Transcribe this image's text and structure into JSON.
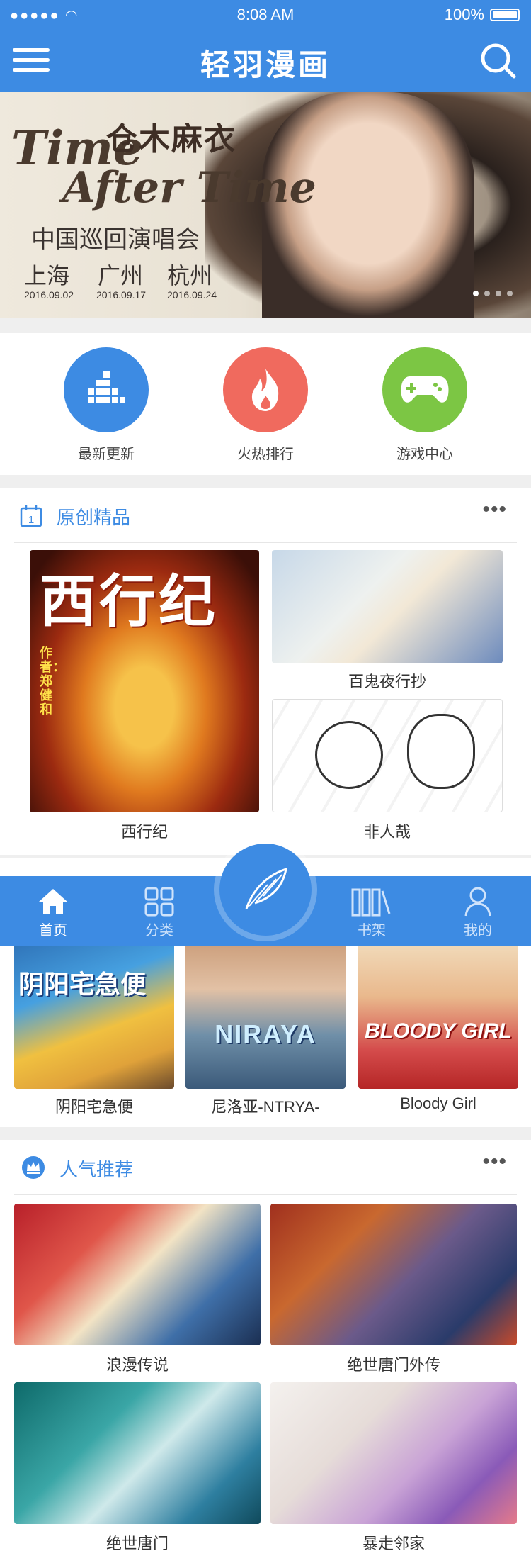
{
  "status": {
    "signal": "●●●●● ",
    "time": "8:08 AM",
    "battery": "100%"
  },
  "header": {
    "title": "轻羽漫画"
  },
  "banner": {
    "line1": "Time",
    "line2": "After Time",
    "artist": "仓木麻衣",
    "subtitle": "中国巡回演唱会",
    "cities": [
      {
        "city": "上海",
        "date": "2016.09.02"
      },
      {
        "city": "广州",
        "date": "2016.09.17"
      },
      {
        "city": "杭州",
        "date": "2016.09.24"
      }
    ]
  },
  "categories": [
    {
      "label": "最新更新",
      "color": "#3d8be3",
      "icon": "bar-blocks-icon"
    },
    {
      "label": "火热排行",
      "color": "#f06a5e",
      "icon": "flame-icon"
    },
    {
      "label": "游戏中心",
      "color": "#7cc644",
      "icon": "gamepad-icon"
    }
  ],
  "original": {
    "title": "原创精品",
    "more": "•••",
    "items": [
      {
        "title": "西行纪",
        "cover_text": "西行纪",
        "author_text": "作者：郑健和"
      },
      {
        "title": "百鬼夜行抄"
      },
      {
        "title": "非人哉"
      }
    ]
  },
  "row3": {
    "items": [
      {
        "title": "阴阳宅急便",
        "cover_text": "阴阳宅急便"
      },
      {
        "title": "尼洛亚-NTRYA-",
        "cover_text": "NIRAYA"
      },
      {
        "title": "Bloody Girl",
        "cover_text": "BLOODY GIRL"
      }
    ]
  },
  "popular": {
    "title": "人气推荐",
    "more": "•••",
    "items": [
      {
        "title": "浪漫传说"
      },
      {
        "title": "绝世唐门外传"
      },
      {
        "title": "绝世唐门"
      },
      {
        "title": "暴走邻家"
      }
    ]
  },
  "nav": {
    "items": [
      {
        "label": "首页",
        "icon": "home-icon"
      },
      {
        "label": "分类",
        "icon": "grid-icon"
      },
      {
        "label": "书架",
        "icon": "bookshelf-icon"
      },
      {
        "label": "我的",
        "icon": "user-icon"
      }
    ],
    "center_icon": "feather-icon"
  },
  "colors": {
    "brand": "#3d8be3",
    "background": "#efefef"
  }
}
